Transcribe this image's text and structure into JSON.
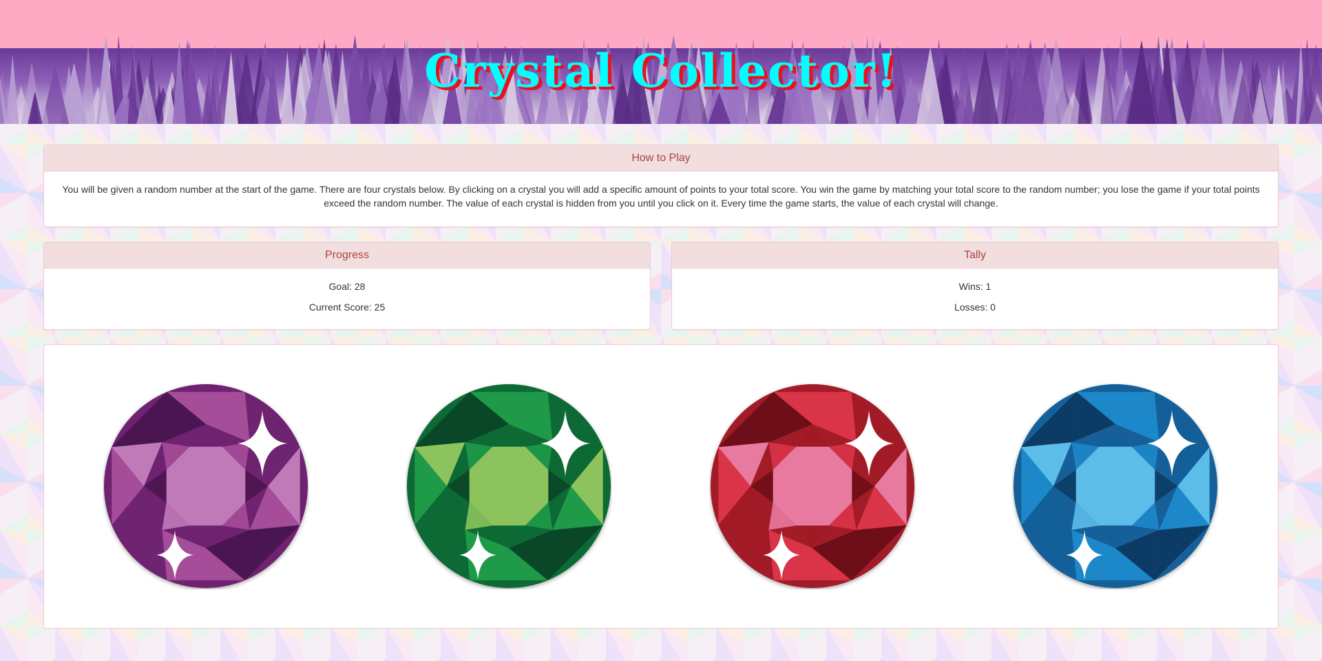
{
  "header": {
    "title": "Crystal Collector!",
    "bg_color": "#ffaac4",
    "title_color": "#00ffff",
    "title_shadow_color": "#e8121e"
  },
  "how_to_play": {
    "heading": "How to Play",
    "text": "You will be given a random number at the start of the game. There are four crystals below. By clicking on a crystal you will add a specific amount of points to your total score. You win the game by matching your total score to the random number; you lose the game if your total points exceed the random number. The value of each crystal is hidden from you until you click on it. Every time the game starts, the value of each crystal will change."
  },
  "progress": {
    "heading": "Progress",
    "goal_label": "Goal: 28",
    "score_label": "Current Score: 25"
  },
  "tally": {
    "heading": "Tally",
    "wins_label": "Wins: 1",
    "losses_label": "Losses: 0"
  },
  "crystals": [
    {
      "name": "purple-crystal",
      "colors": {
        "light": "#c07ab8",
        "mid": "#a54d98",
        "dark": "#6e2470",
        "deep": "#4a1550"
      }
    },
    {
      "name": "green-crystal",
      "colors": {
        "light": "#8cc35d",
        "mid": "#1f9a48",
        "dark": "#0d6a35",
        "deep": "#0a4728"
      }
    },
    {
      "name": "red-crystal",
      "colors": {
        "light": "#e87aa0",
        "mid": "#d93448",
        "dark": "#a11a26",
        "deep": "#6e0e18"
      }
    },
    {
      "name": "blue-crystal",
      "colors": {
        "light": "#5bbde8",
        "mid": "#1d88c9",
        "dark": "#125f99",
        "deep": "#0c3c66"
      }
    }
  ],
  "panel_colors": {
    "heading_bg": "#f2dede",
    "heading_text": "#a94442",
    "border": "#ebccd1"
  }
}
